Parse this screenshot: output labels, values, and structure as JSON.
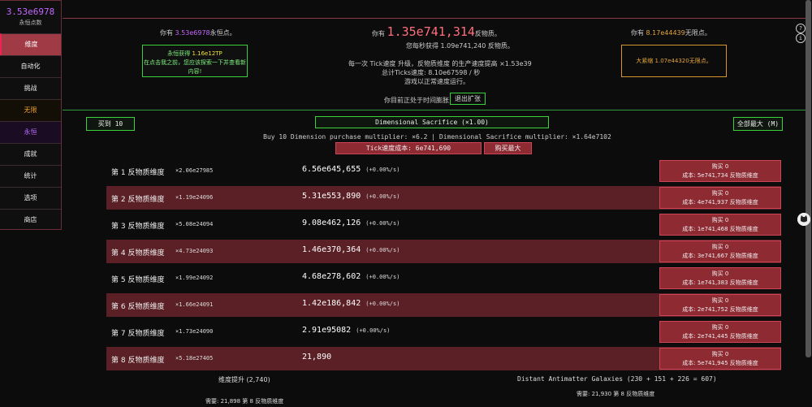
{
  "sidebar": {
    "eternity_points": "3.53e6978",
    "eternity_points_label": "永恒点数",
    "items": [
      {
        "label": "维度"
      },
      {
        "label": "自动化"
      },
      {
        "label": "挑战"
      },
      {
        "label": "无限"
      },
      {
        "label": "永恒"
      },
      {
        "label": "成就"
      },
      {
        "label": "统计"
      },
      {
        "label": "选项"
      },
      {
        "label": "商店"
      }
    ]
  },
  "header": {
    "ep_prefix": "你有",
    "ep_value": "3.53e6978",
    "ep_suffix": "永恒点。",
    "am_prefix": "你有",
    "am_value": "1.35e741,314",
    "am_suffix": "反物质。",
    "am_rate": "您每秒获得 1.09e741,240 反物质。",
    "tick_line": "每一次 Tick速度 升级，反物质维度 的生产速度提高 ×1.53e39",
    "ticks_line": "总计Ticks速度: 8.10e67598 / 秒",
    "game_speed": "游戏以正常速度运行。",
    "ip_prefix": "你有",
    "ip_value": "8.17e44439",
    "ip_suffix": "无限点。",
    "eternity_gain_title": "永恒获得",
    "eternity_gain_value": "1.16e12TP",
    "eternity_gain_hint": "在点击我之前，您应该探索一下并查看新内容!",
    "big_crunch_label": "大紧缩",
    "big_crunch_value": "1.07e44320无限点。",
    "help_icon": "?",
    "info_icon": "i",
    "dilation_status": "你目前正处于时间膨胀",
    "dilation_exit": "退出扩张"
  },
  "controls": {
    "buy_until": "买到 10",
    "sacrifice": "Dimensional Sacrifice (×1.00)",
    "max_all": "全部最大 (M)",
    "multiplier_info": "Buy 10 Dimension purchase multiplier: ×6.2 | Dimensional Sacrifice multiplier: ×1.64e7102",
    "tickspeed_cost": "Tick速度成本: 6e741,690",
    "buy_max": "购买最大"
  },
  "dimensions": [
    {
      "name": "第 1 反物质维度",
      "mult": "×2.06e27985",
      "amount": "6.56e645,655",
      "rate": "(+0.00%/s)",
      "bought": "购买 0",
      "cost": "成本: 5e741,734 反物质维度"
    },
    {
      "name": "第 2 反物质维度",
      "mult": "×1.19e24096",
      "amount": "5.31e553,890",
      "rate": "(+0.00%/s)",
      "bought": "购买 0",
      "cost": "成本: 4e741,937 反物质维度"
    },
    {
      "name": "第 3 反物质维度",
      "mult": "×5.08e24094",
      "amount": "9.08e462,126",
      "rate": "(+0.00%/s)",
      "bought": "购买 0",
      "cost": "成本: 1e741,468 反物质维度"
    },
    {
      "name": "第 4 反物质维度",
      "mult": "×4.73e24093",
      "amount": "1.46e370,364",
      "rate": "(+0.00%/s)",
      "bought": "购买 0",
      "cost": "成本: 3e741,667 反物质维度"
    },
    {
      "name": "第 5 反物质维度",
      "mult": "×1.99e24092",
      "amount": "4.68e278,602",
      "rate": "(+0.00%/s)",
      "bought": "购买 0",
      "cost": "成本: 1e741,383 反物质维度"
    },
    {
      "name": "第 6 反物质维度",
      "mult": "×1.66e24091",
      "amount": "1.42e186,842",
      "rate": "(+0.00%/s)",
      "bought": "购买 0",
      "cost": "成本: 2e741,752 反物质维度"
    },
    {
      "name": "第 7 反物质维度",
      "mult": "×1.73e24090",
      "amount": "2.91e95082",
      "rate": "(+0.00%/s)",
      "bought": "购买 0",
      "cost": "成本: 2e741,445 反物质维度"
    },
    {
      "name": "第 8 反物质维度",
      "mult": "×5.18e27405",
      "amount": "21,890",
      "rate": "",
      "bought": "购买 0",
      "cost": "成本: 5e741,945 反物质维度"
    }
  ],
  "footer": {
    "boost_title": "维度提升 (2,740)",
    "boost_req": "需要: 21,898 第 8 反物质维度",
    "galaxy_title": "Distant Antimatter Galaxies (230 + 151 + 226 = 607)",
    "galaxy_req": "需要: 21,930 第 8 反物质维度"
  }
}
